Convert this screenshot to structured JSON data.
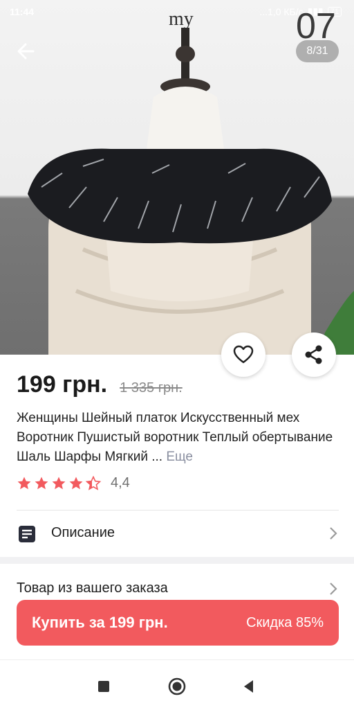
{
  "status": {
    "time": "11:44",
    "speed": "...1,0 КБ/с",
    "battery": "71"
  },
  "photo": {
    "counter": "8/31",
    "overlay_number": "07",
    "overlay_text": "my"
  },
  "product": {
    "price": "199 грн.",
    "old_price": "1 335 грн.",
    "title": "Женщины Шейный платок Искусственный мех Воротник Пушистый воротник Теплый обертывание Шаль Шарфы Мягкий ...",
    "more_label": "Еще",
    "rating": "4,4",
    "stars": 4.4
  },
  "rows": {
    "description": "Описание",
    "order_item": "Товар из вашего заказа"
  },
  "buy": {
    "label": "Купить за 199 грн.",
    "discount": "Скидка 85%"
  },
  "colors": {
    "accent": "#f25a5e",
    "star": "#f25a5e"
  },
  "icons": [
    "back-arrow-icon",
    "heart-icon",
    "share-icon",
    "description-icon",
    "chevron-right-icon",
    "nav-square-icon",
    "nav-home-icon",
    "nav-back-icon"
  ]
}
